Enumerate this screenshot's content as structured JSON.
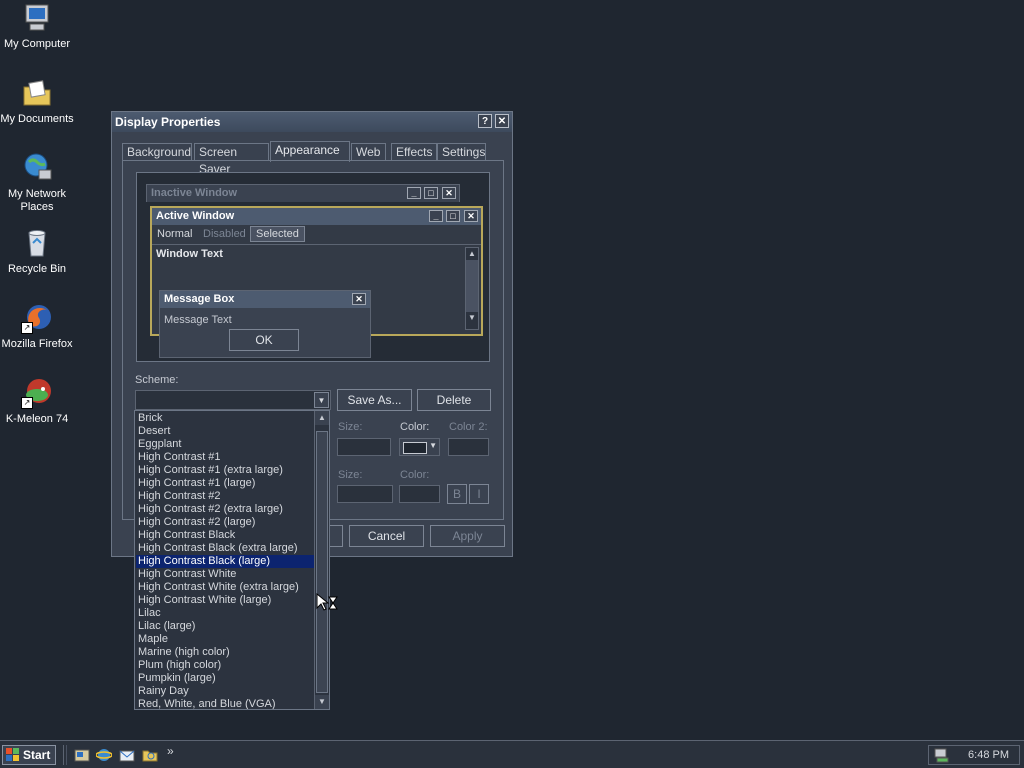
{
  "desktop": {
    "icons": [
      {
        "label": "My Computer",
        "icon": "computer-icon"
      },
      {
        "label": "My Documents",
        "icon": "folder-documents-icon"
      },
      {
        "label": "My Network Places",
        "icon": "network-icon"
      },
      {
        "label": "Recycle Bin",
        "icon": "recycle-bin-icon"
      },
      {
        "label": "Mozilla Firefox",
        "icon": "firefox-icon"
      },
      {
        "label": "K-Meleon 74",
        "icon": "k-meleon-icon"
      }
    ]
  },
  "dialog": {
    "title": "Display Properties",
    "help": "?",
    "close": "✕",
    "tabs": [
      "Background",
      "Screen Saver",
      "Appearance",
      "Web",
      "Effects",
      "Settings"
    ],
    "active_tab": "Appearance",
    "preview": {
      "inactive_title": "Inactive Window",
      "active_title": "Active Window",
      "menu_normal": "Normal",
      "menu_disabled": "Disabled",
      "menu_selected": "Selected",
      "window_text": "Window Text",
      "message_title": "Message Box",
      "message_text": "Message Text",
      "ok": "OK"
    },
    "scheme_label": "Scheme:",
    "save_as": "Save As...",
    "delete": "Delete",
    "item_size_label": "Size:",
    "color_label": "Color:",
    "color2_label": "Color 2:",
    "font_size_label": "Size:",
    "font_color_label": "Color:",
    "bold": "B",
    "italic": "I",
    "cancel": "Cancel",
    "apply": "Apply"
  },
  "scheme_list": {
    "items": [
      "Brick",
      "Desert",
      "Eggplant",
      "High Contrast #1",
      "High Contrast #1 (extra large)",
      "High Contrast #1 (large)",
      "High Contrast #2",
      "High Contrast #2 (extra large)",
      "High Contrast #2 (large)",
      "High Contrast Black",
      "High Contrast Black (extra large)",
      "High Contrast Black (large)",
      "High Contrast White",
      "High Contrast White (extra large)",
      "High Contrast White (large)",
      "Lilac",
      "Lilac (large)",
      "Maple",
      "Marine (high color)",
      "Plum (high color)",
      "Pumpkin (large)",
      "Rainy Day",
      "Red, White, and Blue (VGA)"
    ],
    "selected": "High Contrast Black (large)"
  },
  "taskbar": {
    "start": "Start",
    "chevron": "»",
    "clock": "6:48 PM"
  },
  "colors": {
    "desktop": "#1f2630",
    "accent_active": "#4d5b70",
    "selection": "#0c2470"
  }
}
